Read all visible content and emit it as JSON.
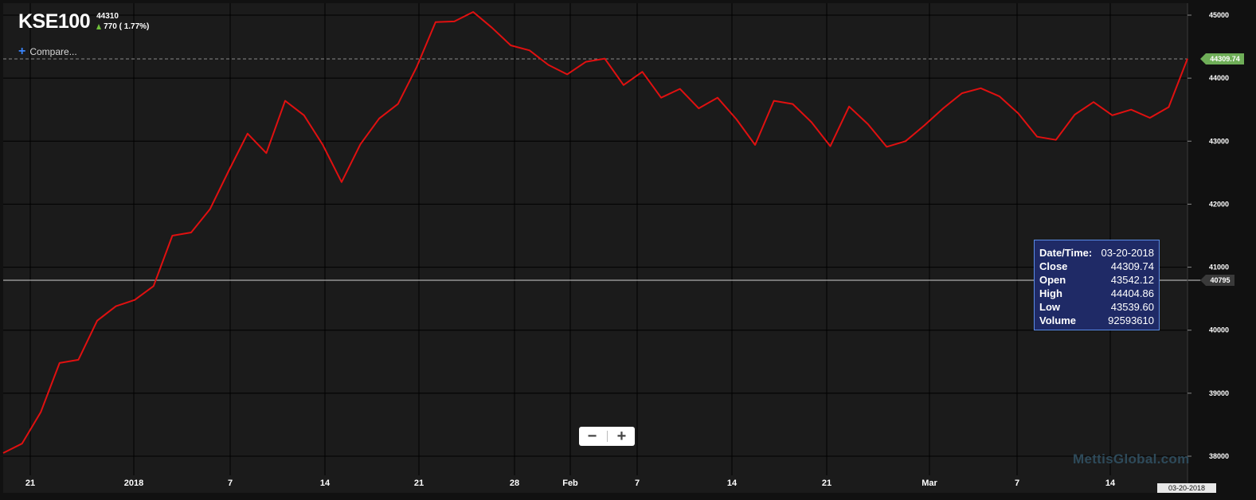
{
  "header": {
    "symbol": "KSE100",
    "last": "44310",
    "change": "770 ( 1.77%)"
  },
  "compare_label": "Compare...",
  "tooltip": {
    "rows": [
      {
        "label": "Date/Time:",
        "value": "03-20-2018"
      },
      {
        "label": "Close",
        "value": "44309.74"
      },
      {
        "label": "Open",
        "value": "43542.12"
      },
      {
        "label": "High",
        "value": "44404.86"
      },
      {
        "label": "Low",
        "value": "43539.60"
      },
      {
        "label": "Volume",
        "value": "92593610"
      }
    ]
  },
  "price_tags": {
    "last": "44309.74",
    "cursor": "40795",
    "date": "03-20-2018"
  },
  "zoom": {
    "minus": "−",
    "plus": "+"
  },
  "watermark": "MettisGlobal.com",
  "colors": {
    "line": "#e01010",
    "background": "#131313",
    "grid": "#000000",
    "tooltip_bg": "#1f2a66",
    "up": "#6fbf3b"
  },
  "chart_data": {
    "type": "line",
    "ylim": [
      37800,
      45100
    ],
    "y_ticks": [
      38000,
      39000,
      40000,
      41000,
      42000,
      43000,
      44000,
      45000
    ],
    "x_ticks": [
      "21",
      "2018",
      "7",
      "14",
      "21",
      "28",
      "Feb",
      "7",
      "14",
      "21",
      "Mar",
      "7",
      "14"
    ],
    "last_value_line": 44309.74,
    "cursor_value": 40795,
    "series": [
      {
        "values": [
          38050,
          38200,
          38700,
          39480,
          39530,
          40150,
          40380,
          40480,
          40700,
          41500,
          41550,
          41920,
          42530,
          43120,
          42810,
          43640,
          43410,
          42940,
          42350,
          42950,
          43360,
          43590,
          44180,
          44890,
          44900,
          45050,
          44800,
          44520,
          44440,
          44210,
          44060,
          44260,
          44310,
          43890,
          44100,
          43690,
          43830,
          43520,
          43690,
          43350,
          42940,
          43640,
          43590,
          43300,
          42920,
          43550,
          43270,
          42910,
          43000,
          43250,
          43520,
          43760,
          43840,
          43710,
          43440,
          43070,
          43020,
          43420,
          43620,
          43410,
          43500,
          43370,
          43540,
          44309.74
        ]
      }
    ]
  }
}
